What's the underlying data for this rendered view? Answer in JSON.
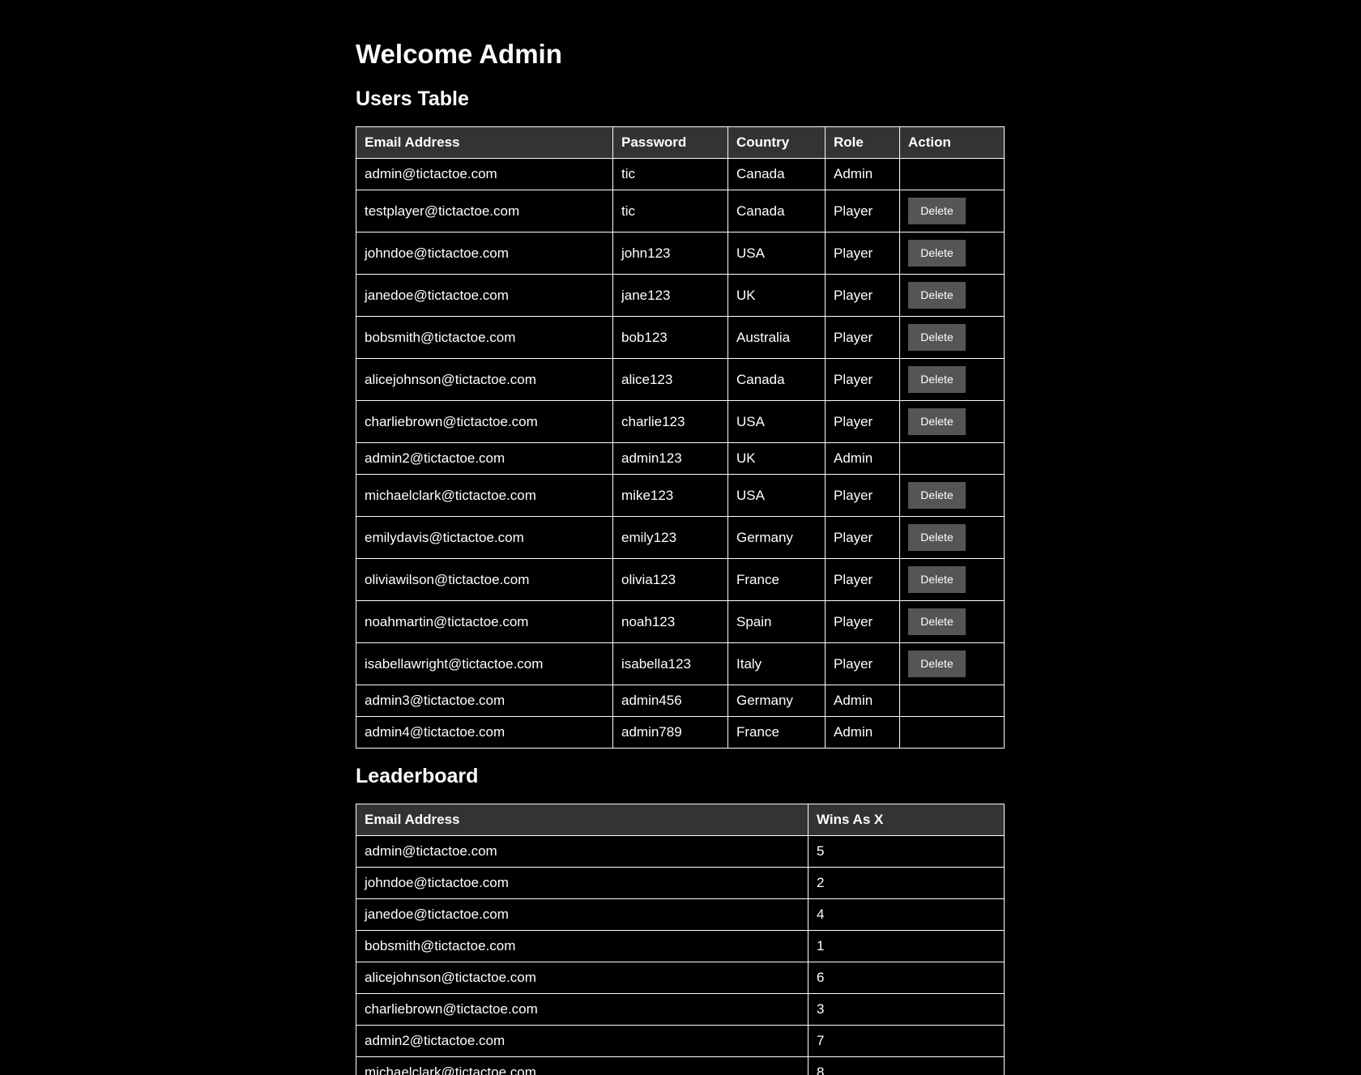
{
  "page": {
    "title": "Welcome Admin"
  },
  "users": {
    "heading": "Users Table",
    "columns": [
      "Email Address",
      "Password",
      "Country",
      "Role",
      "Action"
    ],
    "delete_label": "Delete",
    "rows": [
      {
        "email": "admin@tictactoe.com",
        "password": "tic",
        "country": "Canada",
        "role": "Admin"
      },
      {
        "email": "testplayer@tictactoe.com",
        "password": "tic",
        "country": "Canada",
        "role": "Player"
      },
      {
        "email": "johndoe@tictactoe.com",
        "password": "john123",
        "country": "USA",
        "role": "Player"
      },
      {
        "email": "janedoe@tictactoe.com",
        "password": "jane123",
        "country": "UK",
        "role": "Player"
      },
      {
        "email": "bobsmith@tictactoe.com",
        "password": "bob123",
        "country": "Australia",
        "role": "Player"
      },
      {
        "email": "alicejohnson@tictactoe.com",
        "password": "alice123",
        "country": "Canada",
        "role": "Player"
      },
      {
        "email": "charliebrown@tictactoe.com",
        "password": "charlie123",
        "country": "USA",
        "role": "Player"
      },
      {
        "email": "admin2@tictactoe.com",
        "password": "admin123",
        "country": "UK",
        "role": "Admin"
      },
      {
        "email": "michaelclark@tictactoe.com",
        "password": "mike123",
        "country": "USA",
        "role": "Player"
      },
      {
        "email": "emilydavis@tictactoe.com",
        "password": "emily123",
        "country": "Germany",
        "role": "Player"
      },
      {
        "email": "oliviawilson@tictactoe.com",
        "password": "olivia123",
        "country": "France",
        "role": "Player"
      },
      {
        "email": "noahmartin@tictactoe.com",
        "password": "noah123",
        "country": "Spain",
        "role": "Player"
      },
      {
        "email": "isabellawright@tictactoe.com",
        "password": "isabella123",
        "country": "Italy",
        "role": "Player"
      },
      {
        "email": "admin3@tictactoe.com",
        "password": "admin456",
        "country": "Germany",
        "role": "Admin"
      },
      {
        "email": "admin4@tictactoe.com",
        "password": "admin789",
        "country": "France",
        "role": "Admin"
      }
    ]
  },
  "leaderboard": {
    "heading": "Leaderboard",
    "columns": [
      "Email Address",
      "Wins As X"
    ],
    "rows": [
      {
        "email": "admin@tictactoe.com",
        "wins": "5"
      },
      {
        "email": "johndoe@tictactoe.com",
        "wins": "2"
      },
      {
        "email": "janedoe@tictactoe.com",
        "wins": "4"
      },
      {
        "email": "bobsmith@tictactoe.com",
        "wins": "1"
      },
      {
        "email": "alicejohnson@tictactoe.com",
        "wins": "6"
      },
      {
        "email": "charliebrown@tictactoe.com",
        "wins": "3"
      },
      {
        "email": "admin2@tictactoe.com",
        "wins": "7"
      },
      {
        "email": "michaelclark@tictactoe.com",
        "wins": "8"
      }
    ]
  },
  "colors": {
    "background": "#000000",
    "text": "#ffffff",
    "header_bg": "#333333",
    "button_bg": "#555555",
    "border": "#ffffff"
  }
}
